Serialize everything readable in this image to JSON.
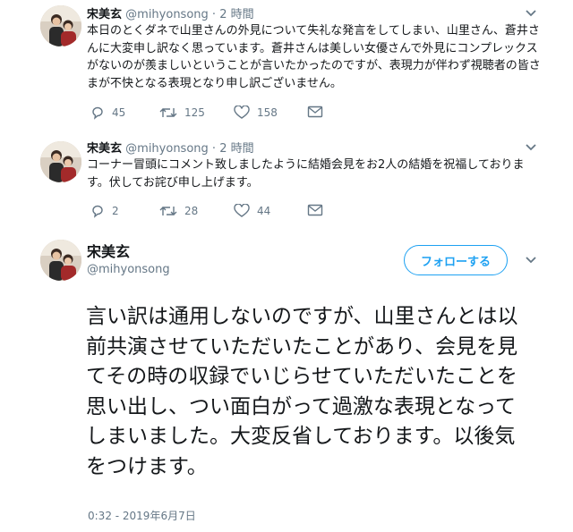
{
  "tweets": [
    {
      "name": "宋美玄",
      "handle": "@mihyonsong",
      "dot": "·",
      "time": "2 時間",
      "text": "本日のとくダネで山里さんの外見について失礼な発言をしてしまい、山里さん、蒼井さんに大変申し訳なく思っています。蒼井さんは美しい女優さんで外見にコンプレックスがないのが羨ましいということが言いたかったのですが、表現力が伴わず視聴者の皆さまが不快となる表現となり申し訳ございません。",
      "replies": "45",
      "retweets": "125",
      "likes": "158"
    },
    {
      "name": "宋美玄",
      "handle": "@mihyonsong",
      "dot": "·",
      "time": "2 時間",
      "text": "コーナー冒頭にコメント致しましたように結婚会見をお2人の結婚を祝福しております。伏してお詫び申し上げます。",
      "replies": "2",
      "retweets": "28",
      "likes": "44"
    }
  ],
  "main": {
    "name": "宋美玄",
    "handle": "@mihyonsong",
    "follow_label": "フォローする",
    "text": "言い訳は通用しないのですが、山里さんとは以前共演させていただいたことがあり、会見を見てその時の収録でいじらせていただいたことを思い出し、つい面白がって過激な表現となってしまいました。大変反省しております。以後気をつけます。",
    "timestamp": "0:32 - 2019年6月7日"
  },
  "colors": {
    "accent": "#1da1f2",
    "muted": "#657786",
    "text": "#14171a"
  }
}
